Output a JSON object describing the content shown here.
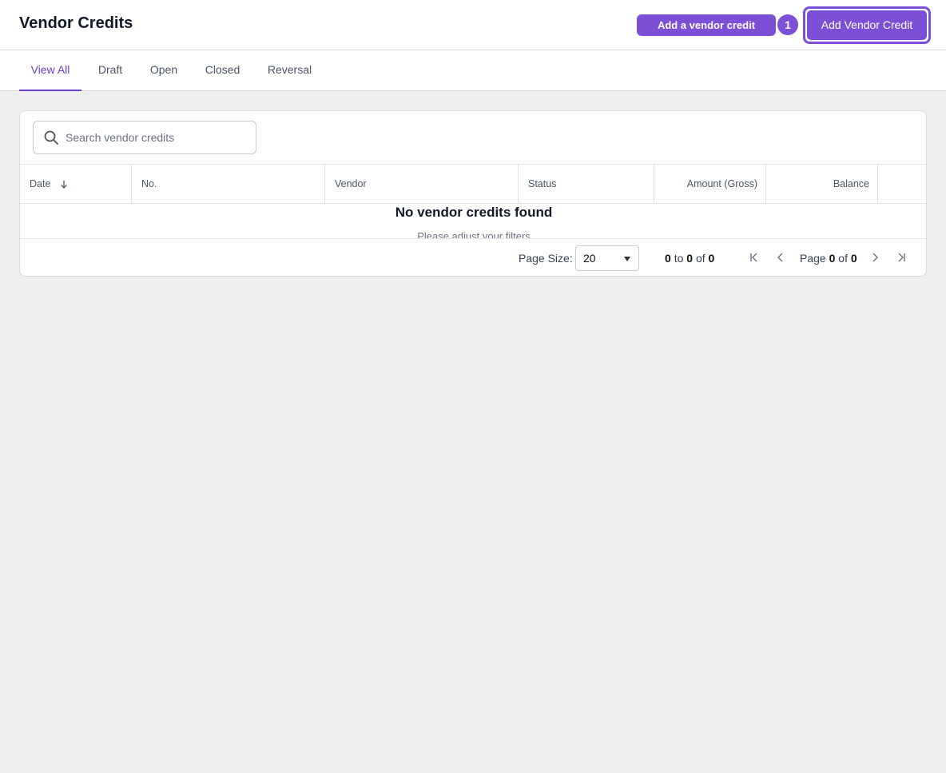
{
  "header": {
    "title": "Vendor Credits",
    "tooltip_label": "Add a vendor credit",
    "step_number": "1",
    "add_button_label": "Add Vendor Credit"
  },
  "tabs": [
    {
      "label": "View All",
      "active": true
    },
    {
      "label": "Draft",
      "active": false
    },
    {
      "label": "Open",
      "active": false
    },
    {
      "label": "Closed",
      "active": false
    },
    {
      "label": "Reversal",
      "active": false
    }
  ],
  "search": {
    "placeholder": "Search vendor credits",
    "value": ""
  },
  "table": {
    "columns": [
      "Date",
      "No.",
      "Vendor",
      "Status",
      "Amount (Gross)",
      "Balance"
    ],
    "sort_column": "Date",
    "sort_direction": "descending",
    "empty_title": "No vendor credits found",
    "empty_subtitle": "Please adjust your filters"
  },
  "pagination": {
    "page_size_label": "Page Size:",
    "page_size": "20",
    "range_from": "0",
    "range_to": "0",
    "range_total": "0",
    "word_to": "to",
    "word_of": "of",
    "word_page": "Page",
    "page_current": "0",
    "page_total": "0"
  },
  "colors": {
    "accent": "#7b4fd6",
    "active_tab": "#6b3fcf",
    "background": "#eeeeee"
  },
  "icons": [
    "search-icon",
    "sort-down-arrow-icon",
    "first-page-icon",
    "previous-page-icon",
    "next-page-icon",
    "last-page-icon",
    "dropdown-caret-icon"
  ]
}
